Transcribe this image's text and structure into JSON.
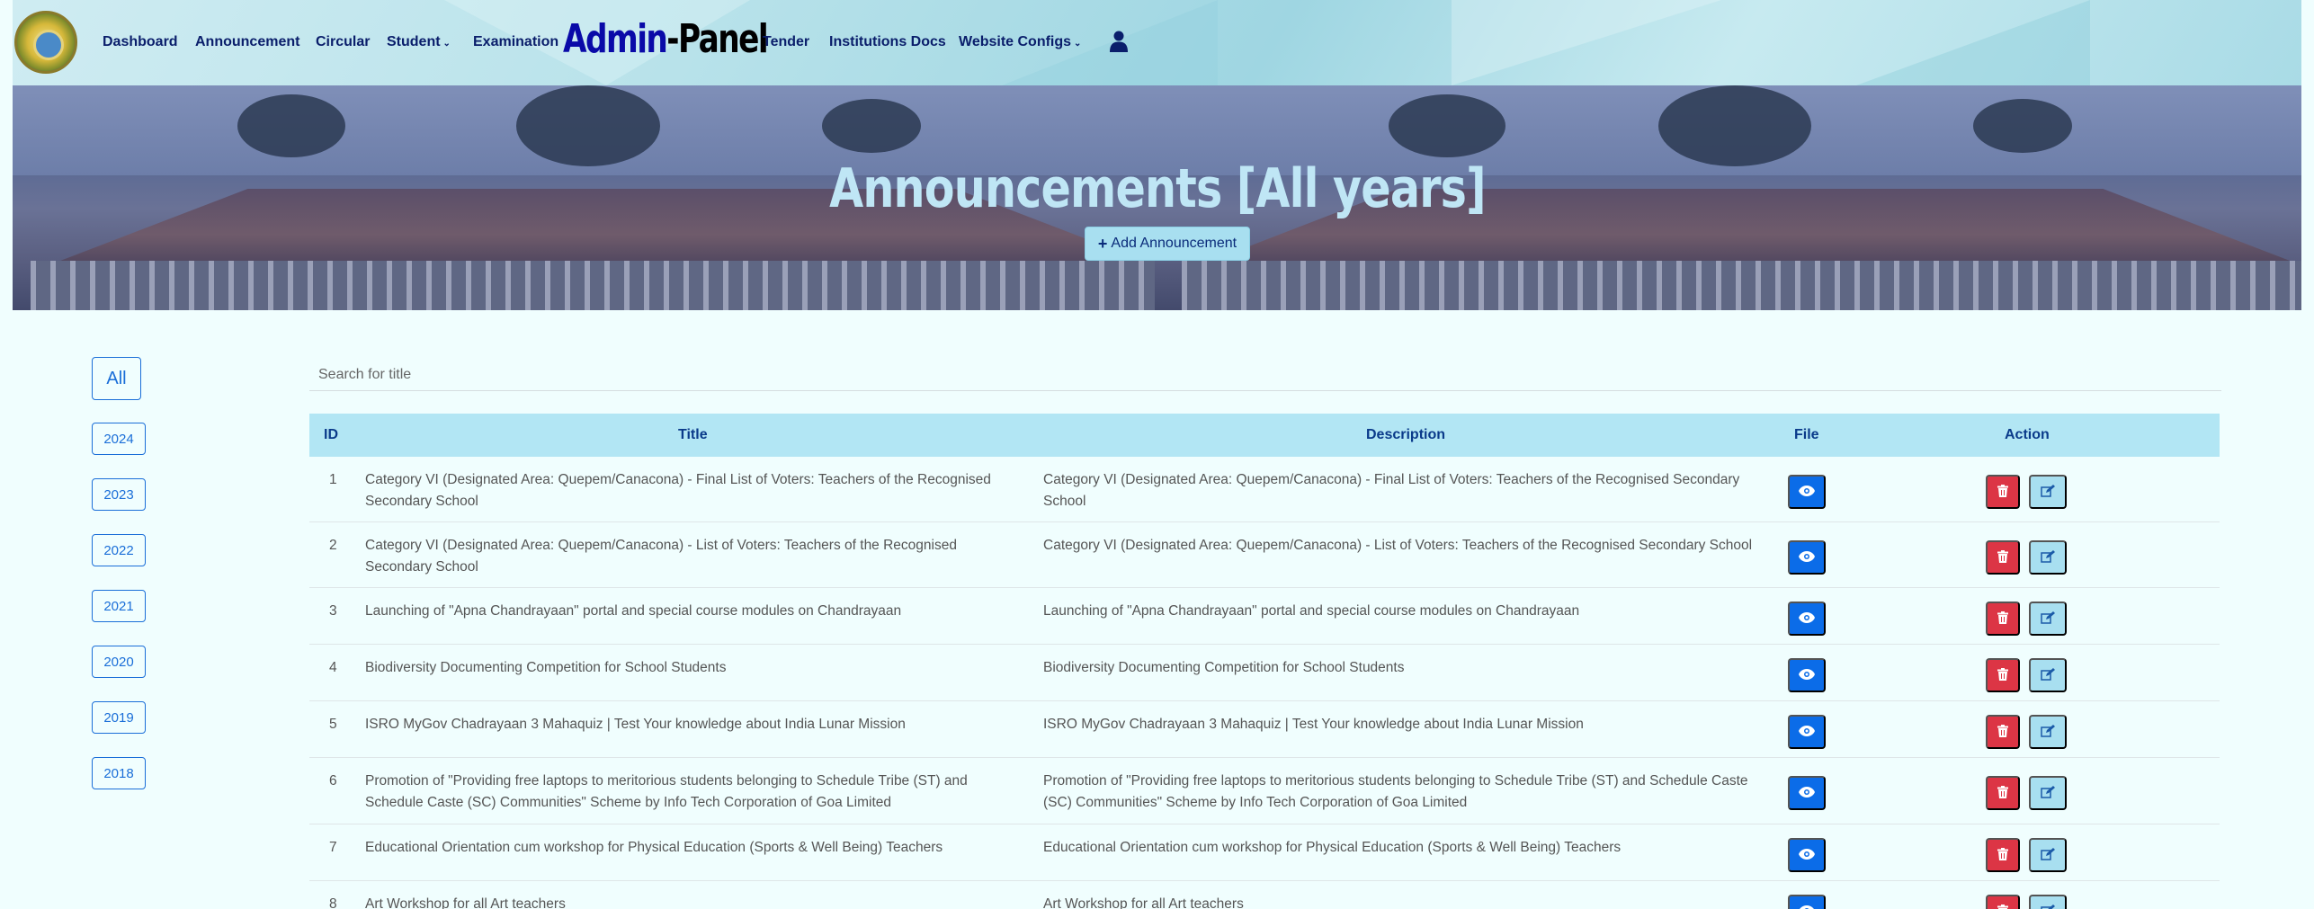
{
  "nav": {
    "items": [
      "Dashboard",
      "Announcement",
      "Circular",
      "Student",
      "Examination"
    ],
    "brand_part1": "Admin",
    "brand_part2": "-Panel",
    "items_right": [
      "Tender",
      "Institutions Docs",
      "Website Configs"
    ]
  },
  "hero": {
    "title": "Announcements [All years]",
    "add_button": "Add Announcement"
  },
  "years": [
    "All",
    "2024",
    "2023",
    "2022",
    "2021",
    "2020",
    "2019",
    "2018"
  ],
  "search": {
    "placeholder": "Search for title"
  },
  "table": {
    "headers": {
      "id": "ID",
      "title": "Title",
      "description": "Description",
      "file": "File",
      "action": "Action"
    },
    "rows": [
      {
        "id": "1",
        "title": "Category VI (Designated Area: Quepem/Canacona) - Final List of Voters: Teachers of the Recognised Secondary School",
        "description": "Category VI (Designated Area: Quepem/Canacona) - Final List of Voters: Teachers of the Recognised Secondary School"
      },
      {
        "id": "2",
        "title": "Category VI (Designated Area: Quepem/Canacona) - List of Voters: Teachers of the Recognised Secondary School",
        "description": "Category VI (Designated Area: Quepem/Canacona) - List of Voters: Teachers of the Recognised Secondary School"
      },
      {
        "id": "3",
        "title": "Launching of \"Apna Chandrayaan\" portal and special course modules on Chandrayaan",
        "description": "Launching of \"Apna Chandrayaan\" portal and special course modules on Chandrayaan"
      },
      {
        "id": "4",
        "title": "Biodiversity Documenting Competition for School Students",
        "description": "Biodiversity Documenting Competition for School Students"
      },
      {
        "id": "5",
        "title": "ISRO MyGov Chadrayaan 3 Mahaquiz | Test Your knowledge about India Lunar Mission",
        "description": "ISRO MyGov Chadrayaan 3 Mahaquiz | Test Your knowledge about India Lunar Mission"
      },
      {
        "id": "6",
        "title": "Promotion of \"Providing free laptops to meritorious students belonging to Schedule Tribe (ST) and Schedule Caste (SC) Communities\" Scheme by Info Tech Corporation of Goa Limited",
        "description": "Promotion of \"Providing free laptops to meritorious students belonging to Schedule Tribe (ST) and Schedule Caste (SC) Communities\" Scheme by Info Tech Corporation of Goa Limited"
      },
      {
        "id": "7",
        "title": "Educational Orientation cum workshop for Physical Education (Sports & Well Being) Teachers",
        "description": "Educational Orientation cum workshop for Physical Education (Sports & Well Being) Teachers"
      },
      {
        "id": "8",
        "title": "Art Workshop for all Art teachers",
        "description": "Art Workshop for all Art teachers"
      }
    ]
  },
  "colors": {
    "primary": "#0b6ce8",
    "danger": "#dc3545",
    "info": "#a8dff0",
    "header_bg": "#b2e6f4",
    "page_bg": "#f0fefe"
  },
  "icons": {
    "file": "eye-icon",
    "delete": "trash-icon",
    "edit": "edit-icon",
    "user": "user-icon",
    "add": "plus-icon"
  }
}
